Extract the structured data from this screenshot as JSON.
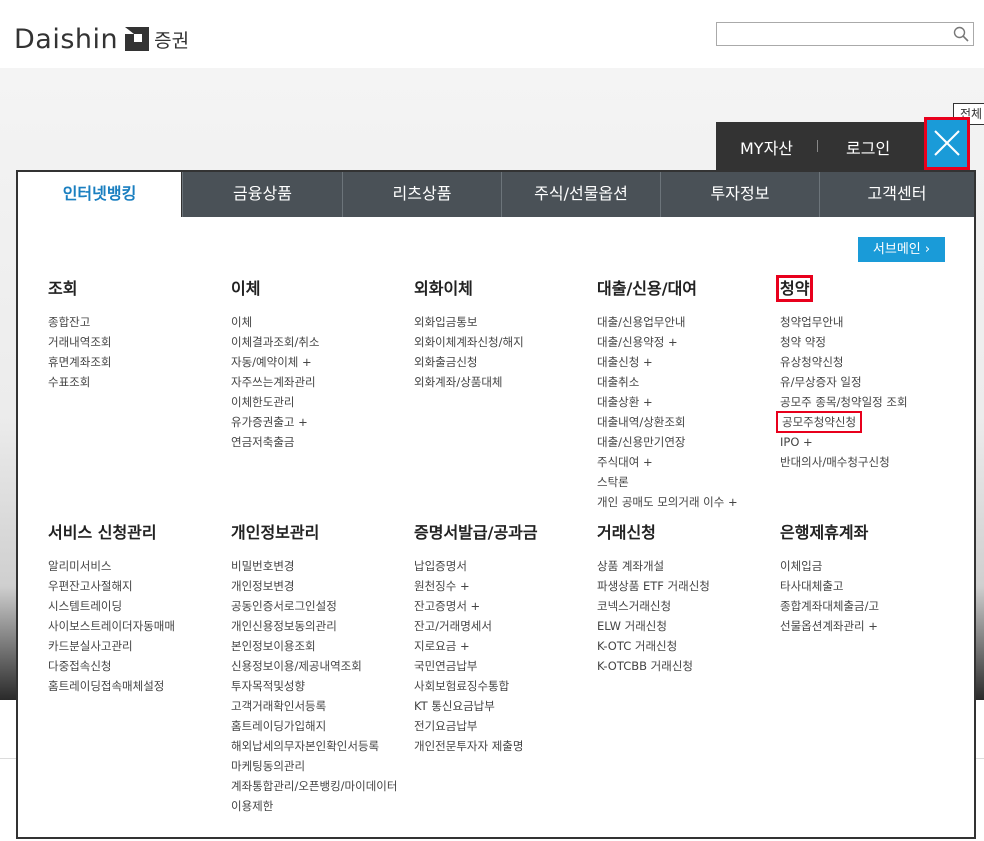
{
  "header": {
    "logo_text": "Daishin",
    "logo_sub": "증권",
    "search_placeholder": ""
  },
  "tooltip": "전체",
  "topbar": {
    "my_assets": "MY자산",
    "login": "로그인"
  },
  "colors": {
    "accent": "#1a9bd8",
    "highlight": "#e8001c",
    "tab_bg": "#4a5157",
    "active_tab_text": "#1a7fc0"
  },
  "tabs": [
    {
      "label": "인터넷뱅킹",
      "active": true
    },
    {
      "label": "금융상품",
      "active": false
    },
    {
      "label": "리츠상품",
      "active": false
    },
    {
      "label": "주식/선물옵션",
      "active": false
    },
    {
      "label": "투자정보",
      "active": false
    },
    {
      "label": "고객센터",
      "active": false
    }
  ],
  "sub_main_label": "서브메인 ›",
  "sections_row1": [
    {
      "title": "조회",
      "items": [
        "종합잔고",
        "거래내역조회",
        "휴면계좌조회",
        "수표조회"
      ]
    },
    {
      "title": "이체",
      "items": [
        "이체",
        "이체결과조회/취소",
        "자동/예약이체 +",
        "자주쓰는계좌관리",
        "이체한도관리",
        "유가증권출고 +",
        "연금저축출금"
      ]
    },
    {
      "title": "외화이체",
      "items": [
        "외화입금통보",
        "외화이체계좌신청/해지",
        "외화출금신청",
        "외화계좌/상품대체"
      ]
    },
    {
      "title": "대출/신용/대여",
      "items": [
        "대출/신용업무안내",
        "대출/신용약정 +",
        "대출신청 +",
        "대출취소",
        "대출상환 +",
        "대출내역/상환조회",
        "대출/신용만기연장",
        "주식대여 +",
        "스탁론",
        "개인 공매도 모의거래 이수 +"
      ]
    },
    {
      "title": "청약",
      "items": [
        "청약업무안내",
        "청약 약정",
        "유상청약신청",
        "유/무상증자 일정",
        "공모주 종목/청약일정 조회",
        "공모주청약신청",
        "IPO +",
        "반대의사/매수청구신청"
      ]
    }
  ],
  "sections_row2": [
    {
      "title": "서비스 신청관리",
      "items": [
        "알리미서비스",
        "우편잔고사절해지",
        "시스템트레이딩",
        "사이보스트레이더자동매매",
        "카드분실사고관리",
        "다중접속신청",
        "홈트레이딩접속매체설정"
      ]
    },
    {
      "title": "개인정보관리",
      "items": [
        "비밀번호변경",
        "개인정보변경",
        "공동인증서로그인설정",
        "개인신용정보동의관리",
        "본인정보이용조회",
        "신용정보이용/제공내역조회",
        "투자목적및성향",
        "고객거래확인서등록",
        "홈트레이딩가입해지",
        "해외납세의무자본인확인서등록",
        "마케팅동의관리",
        "계좌통합관리/오픈뱅킹/마이데이터",
        "이용제한"
      ]
    },
    {
      "title": "증명서발급/공과금",
      "items": [
        "납입증명서",
        "원천징수 +",
        "잔고증명서 +",
        "잔고/거래명세서",
        "지로요금 +",
        "국민연금납부",
        "사회보험료징수통합",
        "KT 통신요금납부",
        "전기요금납부",
        "개인전문투자자 제출명"
      ]
    },
    {
      "title": "거래신청",
      "items": [
        "상품 계좌개설",
        "파생상품 ETF 거래신청",
        "코넥스거래신청",
        "ELW 거래신청",
        "K-OTC 거래신청",
        "K-OTCBB 거래신청"
      ]
    },
    {
      "title": "은행제휴계좌",
      "items": [
        "이체입금",
        "타사대체출고",
        "종합계좌대체출금/고",
        "선물옵션계좌관리 +"
      ]
    }
  ]
}
